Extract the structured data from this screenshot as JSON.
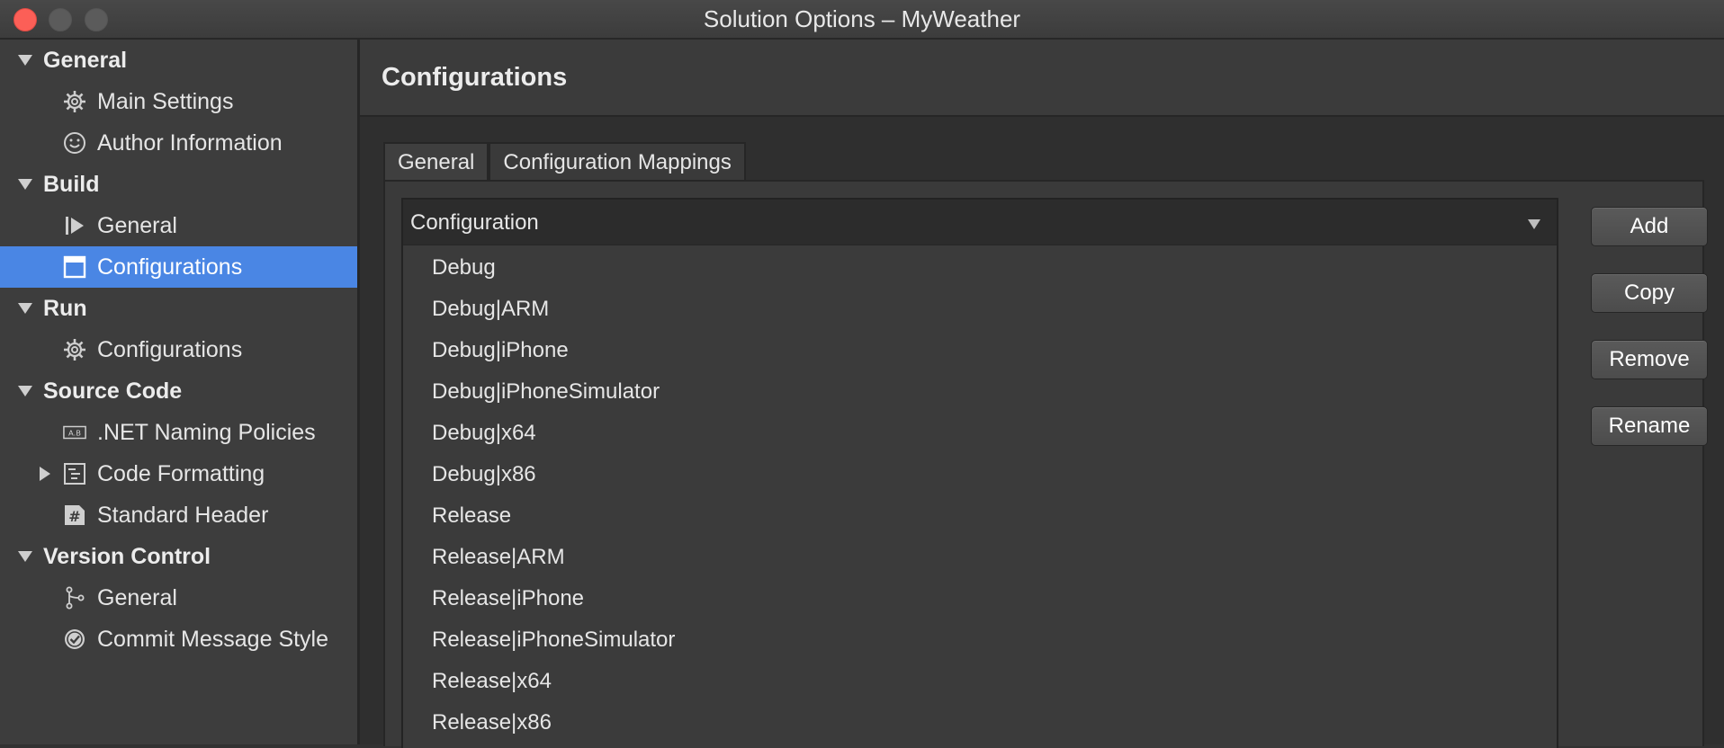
{
  "window": {
    "title": "Solution Options – MyWeather"
  },
  "sidebar": {
    "sections": [
      {
        "label": "General",
        "items": [
          {
            "label": "Main Settings",
            "icon": "gear-icon"
          },
          {
            "label": "Author Information",
            "icon": "smiley-icon"
          }
        ]
      },
      {
        "label": "Build",
        "items": [
          {
            "label": "General",
            "icon": "build-play-icon"
          },
          {
            "label": "Configurations",
            "icon": "window-icon",
            "selected": true
          }
        ]
      },
      {
        "label": "Run",
        "items": [
          {
            "label": "Configurations",
            "icon": "gear-icon"
          }
        ]
      },
      {
        "label": "Source Code",
        "items": [
          {
            "label": ".NET Naming Policies",
            "icon": "naming-ab-icon"
          },
          {
            "label": "Code Formatting",
            "icon": "code-format-icon",
            "collapsed": true
          },
          {
            "label": "Standard Header",
            "icon": "hash-icon"
          }
        ]
      },
      {
        "label": "Version Control",
        "items": [
          {
            "label": "General",
            "icon": "branch-icon"
          },
          {
            "label": "Commit Message Style",
            "icon": "check-circle-icon"
          }
        ]
      }
    ],
    "selected_color": "#4a86e4"
  },
  "main": {
    "title": "Configurations",
    "tabs": [
      {
        "label": "General",
        "active": true
      },
      {
        "label": "Configuration Mappings",
        "active": false
      }
    ],
    "list": {
      "header": "Configuration",
      "rows": [
        "Debug",
        "Debug|ARM",
        "Debug|iPhone",
        "Debug|iPhoneSimulator",
        "Debug|x64",
        "Debug|x86",
        "Release",
        "Release|ARM",
        "Release|iPhone",
        "Release|iPhoneSimulator",
        "Release|x64",
        "Release|x86"
      ]
    },
    "buttons": {
      "add": "Add",
      "copy": "Copy",
      "remove": "Remove",
      "rename": "Rename"
    }
  }
}
